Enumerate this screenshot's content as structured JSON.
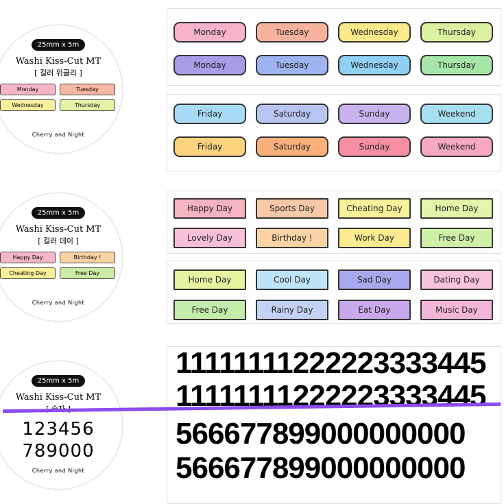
{
  "circles": [
    {
      "size": "25mm x 5m",
      "title": "Washi Kiss-Cut MT",
      "korean": "[ 컬러 위클리 ]",
      "minis": [
        {
          "t": "Monday",
          "c": "#f6b6c8"
        },
        {
          "t": "Tuesday",
          "c": "#f7b7a4"
        },
        {
          "t": "Wednesday",
          "c": "#f9f0a0"
        },
        {
          "t": "Thursday",
          "c": "#e3f2a6"
        }
      ],
      "brand": "Cherry and Night"
    },
    {
      "size": "25mm x 5m",
      "title": "Washi Kiss-Cut MT",
      "korean": "[ 컬러 데이 ]",
      "minis": [
        {
          "t": "Happy Day",
          "c": "#f6b6c8"
        },
        {
          "t": "Birthday !",
          "c": "#f9d3a3"
        },
        {
          "t": "Cheating Day",
          "c": "#f9f29a"
        },
        {
          "t": "Free Day",
          "c": "#cdeaa6"
        }
      ],
      "brand": "Cherry and Night"
    },
    {
      "size": "25mm x 5m",
      "title": "Washi Kiss-Cut MT",
      "korean": "[ 숫자 ]",
      "nums": [
        "123456",
        "789000"
      ],
      "brand": "Cherry and Night"
    }
  ],
  "panels": [
    {
      "rows": [
        [
          {
            "t": "Monday",
            "c": "#f7b3cc"
          },
          {
            "t": "Tuesday",
            "c": "#f8b29e"
          },
          {
            "t": "Wednesday",
            "c": "#fbe98a"
          },
          {
            "t": "Thursday",
            "c": "#dbf0a0"
          }
        ],
        [
          {
            "t": "Monday",
            "c": "#a99be8"
          },
          {
            "t": "Tuesday",
            "c": "#9fb3f0"
          },
          {
            "t": "Wednesday",
            "c": "#8fd0f4"
          },
          {
            "t": "Thursday",
            "c": "#a7e6a8"
          }
        ]
      ]
    },
    {
      "rows": [
        [
          {
            "t": "Friday",
            "c": "#a8dcf6"
          },
          {
            "t": "Saturday",
            "c": "#b8c4f2"
          },
          {
            "t": "Sunday",
            "c": "#c9b3ee"
          },
          {
            "t": "Weekend",
            "c": "#a6e0f0"
          }
        ],
        [
          {
            "t": "Friday",
            "c": "#fbd27e"
          },
          {
            "t": "Saturday",
            "c": "#f9b07a"
          },
          {
            "t": "Sunday",
            "c": "#f78fa4"
          },
          {
            "t": "Weekend",
            "c": "#f6a7c2"
          }
        ]
      ]
    },
    {
      "rows": [
        [
          {
            "t": "Happy Day",
            "c": "#f6b3c2"
          },
          {
            "t": "Sports Day",
            "c": "#f8c9a8"
          },
          {
            "t": "Cheating Day",
            "c": "#f9f29a"
          },
          {
            "t": "Home Day",
            "c": "#e4f4a8"
          }
        ],
        [
          {
            "t": "Lovely Day",
            "c": "#f7c0d6"
          },
          {
            "t": "Birthday !",
            "c": "#f9d3a3"
          },
          {
            "t": "Work Day",
            "c": "#fbeb8e"
          },
          {
            "t": "Free Day",
            "c": "#cfeea8"
          }
        ]
      ]
    },
    {
      "rows": [
        [
          {
            "t": "Home Day",
            "c": "#e4f4a0"
          },
          {
            "t": "Cool Day",
            "c": "#bfe4f8"
          },
          {
            "t": "Sad Day",
            "c": "#a9a8ec"
          },
          {
            "t": "Dating Day",
            "c": "#f9c3dc"
          }
        ],
        [
          {
            "t": "Free Day",
            "c": "#c4ecaa"
          },
          {
            "t": "Rainy Day",
            "c": "#c2d1f4"
          },
          {
            "t": "Eat Day",
            "c": "#c7a9ec"
          },
          {
            "t": "Music Day",
            "c": "#f4b6d8"
          }
        ]
      ]
    }
  ],
  "numbers": [
    "11111111222223333445",
    "11111111222223333445",
    "566677899000000000",
    "566677899000000000"
  ]
}
